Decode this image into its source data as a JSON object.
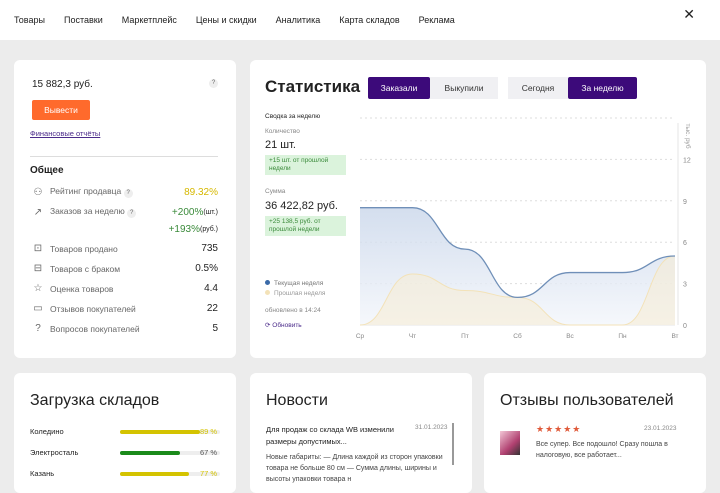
{
  "nav": {
    "items": [
      "Товары",
      "Поставки",
      "Маркетплейс",
      "Цены и скидки",
      "Аналитика",
      "Карта складов",
      "Реклама"
    ],
    "close": "✕"
  },
  "balance": {
    "amount": "15 882,3 руб.",
    "help": "?",
    "withdraw": "Вывести",
    "reports_link": "Финансовые отчёты",
    "section": "Общее",
    "rating_label": "Рейтинг продавца",
    "rating": "89.32%",
    "orders_label": "Заказов за неделю",
    "orders_pcs": "+200%",
    "pcs_unit": "(шт.)",
    "orders_rub": "+193%",
    "rub_unit": "(руб.)",
    "stats": [
      {
        "label": "Товаров продано",
        "value": "735",
        "icon": "box-icon"
      },
      {
        "label": "Товаров с браком",
        "value": "0.5%",
        "icon": "broken-box-icon"
      },
      {
        "label": "Оценка товаров",
        "value": "4.4",
        "icon": "star-icon"
      },
      {
        "label": "Отзывов покупателей",
        "value": "22",
        "icon": "comment-icon"
      },
      {
        "label": "Вопросов покупателей",
        "value": "5",
        "icon": "question-icon"
      }
    ]
  },
  "stats": {
    "title": "Статистика",
    "tabs": [
      "Заказали",
      "Выкупили"
    ],
    "periods": [
      "Сегодня",
      "За неделю"
    ],
    "summary": "Сводка за неделю",
    "qty_label": "Количество",
    "qty": "21 шт.",
    "qty_delta": "+15 шт. от прошлой недели",
    "sum_label": "Сумма",
    "sum": "36 422,82 руб.",
    "sum_delta": "+25 138,5 руб. от прошлой недели",
    "updated": "обновлено в 14:24",
    "refresh": "Обновить"
  },
  "colors": {
    "accent": "#3c0a7a",
    "orange": "#ff6a2c",
    "current": "#6f8fb8",
    "previous": "#f3e2b8"
  },
  "chart_data": {
    "type": "area",
    "x": [
      "Ср",
      "Чт",
      "Пт",
      "Сб",
      "Вс",
      "Пн",
      "Вт"
    ],
    "ylabel": "тыс. руб",
    "ylim": [
      0,
      15
    ],
    "yticks": [
      0,
      3,
      6,
      9,
      12
    ],
    "series": [
      {
        "name": "Текущая неделя",
        "values": [
          8.5,
          8.5,
          5.5,
          2,
          3.8,
          3.8,
          5
        ]
      },
      {
        "name": "Прошлая неделя",
        "values": [
          0,
          3.7,
          2.5,
          2,
          0,
          0,
          5
        ]
      }
    ],
    "legend": "bottom-left",
    "grid": true
  },
  "warehouses": {
    "title": "Загрузка складов",
    "items": [
      {
        "name": "Коледино",
        "pct": 89,
        "label": "89 %",
        "color": "#d4c300"
      },
      {
        "name": "Электросталь",
        "pct": 67,
        "label": "67 %",
        "color": "#1a8a1a"
      },
      {
        "name": "Казань",
        "pct": 77,
        "label": "77 %",
        "color": "#d4c300"
      }
    ]
  },
  "news": {
    "title": "Новости",
    "date": "31.01.2023",
    "headline": "Для продаж со склада WB изменили размеры допустимых...",
    "body": "Новые габариты: — Длина каждой из сторон упаковки товара не больше 80 см — Сумма длины, ширины и высоты упаковки товара н"
  },
  "reviews": {
    "title": "Отзывы пользователей",
    "stars": "★★★★★",
    "date": "23.01.2023",
    "text": "Все супер. Все подошло! Сразу пошла в налоговую, все работает..."
  }
}
